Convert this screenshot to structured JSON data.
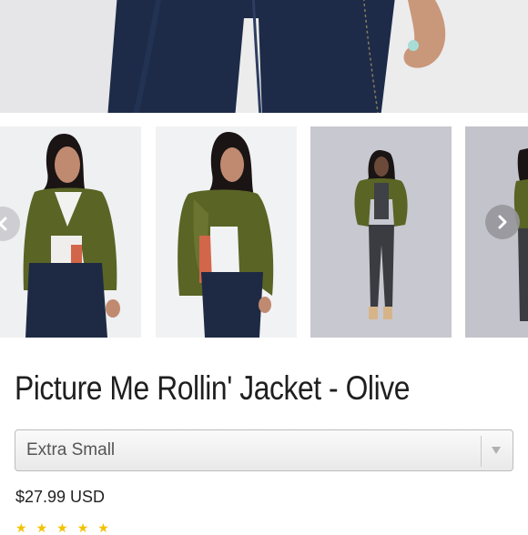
{
  "product": {
    "title": "Picture Me Rollin' Jacket - Olive",
    "size_select": {
      "selected": "Extra Small"
    },
    "price": "$27.99 USD",
    "rating_stars": [
      "★",
      "★",
      "★",
      "★",
      "★"
    ]
  },
  "carousel": {
    "thumbnails": [
      {
        "name": "front-view"
      },
      {
        "name": "side-view"
      },
      {
        "name": "full-body-view"
      },
      {
        "name": "back-view"
      }
    ],
    "prev_icon": "chevron-left-icon",
    "next_icon": "chevron-right-icon"
  },
  "colors": {
    "olive": "#5a6425",
    "denim": "#1e2a44",
    "text": "#1f1f1f"
  }
}
